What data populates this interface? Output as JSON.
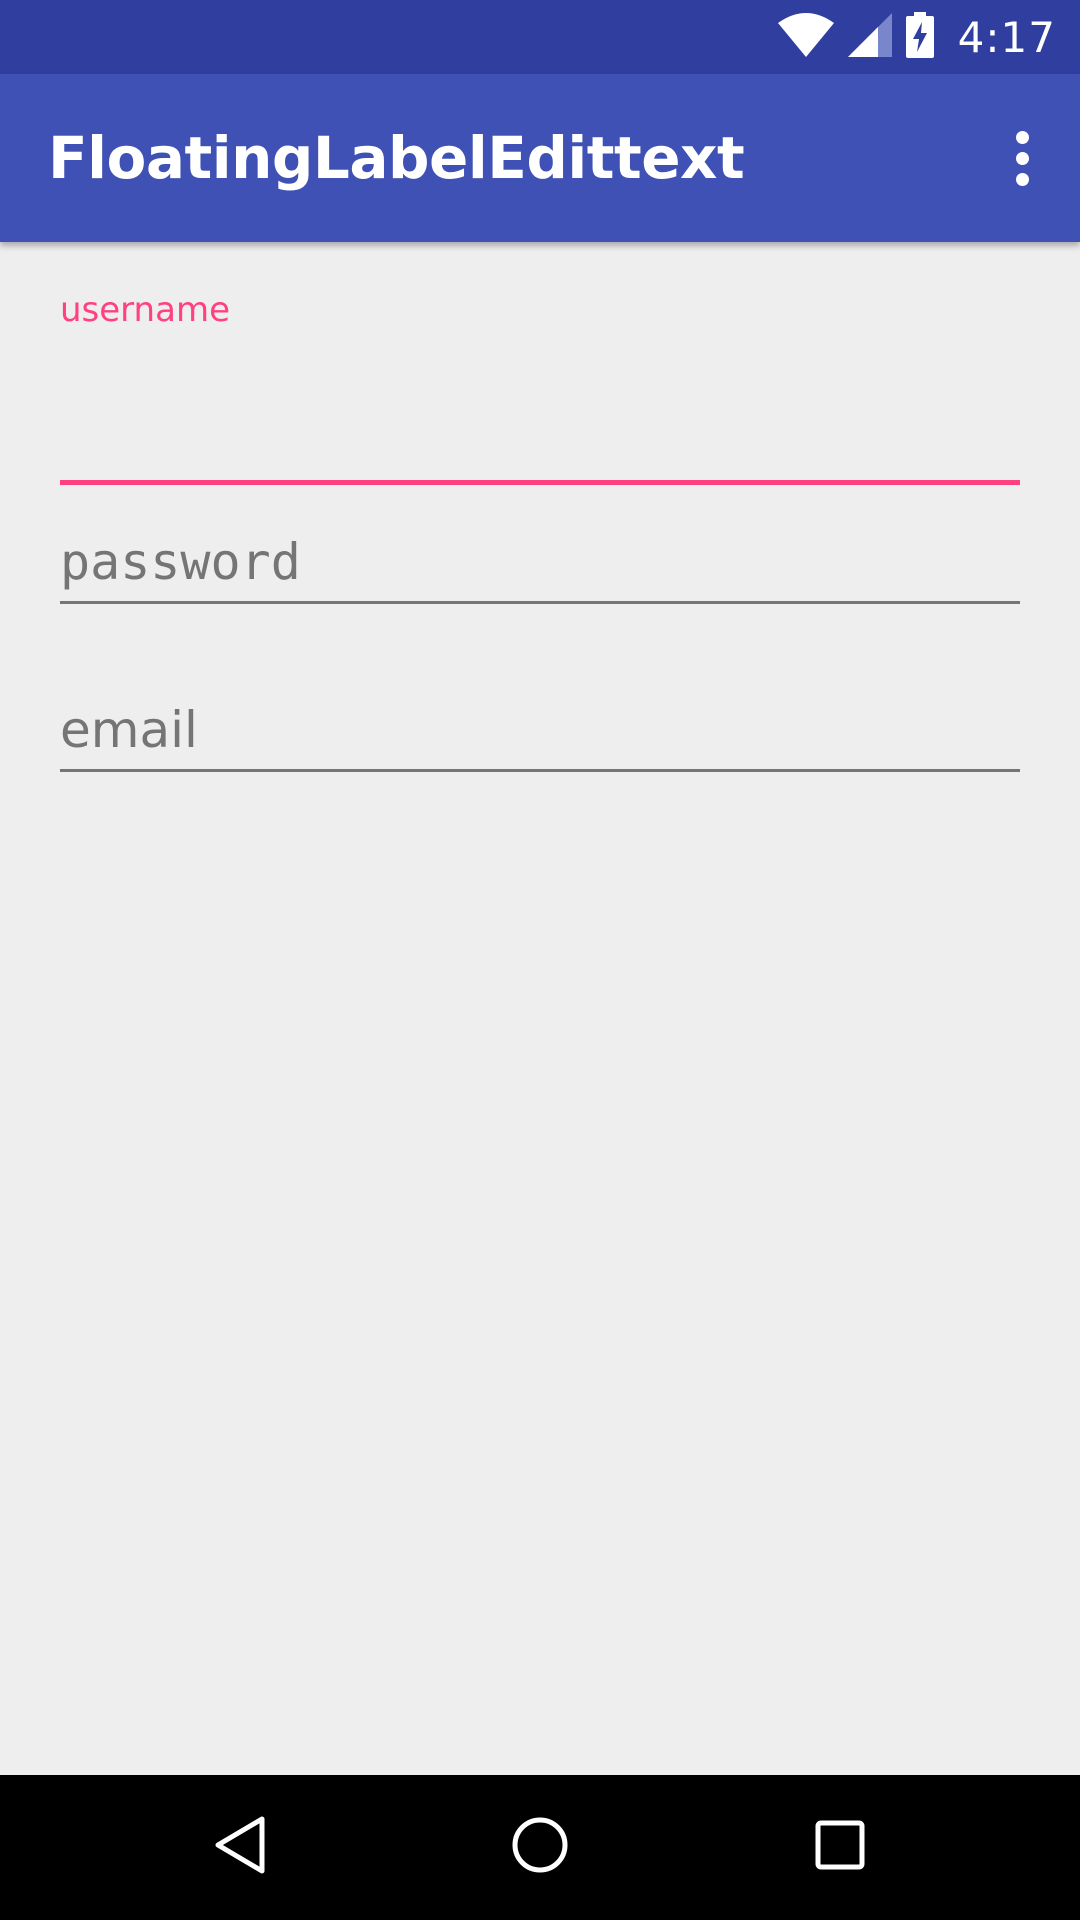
{
  "status_bar": {
    "time": "4:17",
    "icons": [
      "wifi-icon",
      "cell-signal-icon",
      "battery-charging-icon"
    ]
  },
  "app_bar": {
    "title": "FloatingLabelEdittext",
    "menu_icon": "overflow-menu-icon"
  },
  "form": {
    "username": {
      "floating_label": "username",
      "value": "",
      "state": "focused"
    },
    "password": {
      "placeholder": "password",
      "value": ""
    },
    "email": {
      "placeholder": "email",
      "value": ""
    }
  },
  "nav_bar": {
    "buttons": [
      "back-icon",
      "home-icon",
      "recents-icon"
    ]
  },
  "colors": {
    "status_bar": "#303f9f",
    "app_bar": "#3f51b5",
    "accent": "#ff4081",
    "background": "#eeeeee",
    "hint": "#757575"
  }
}
